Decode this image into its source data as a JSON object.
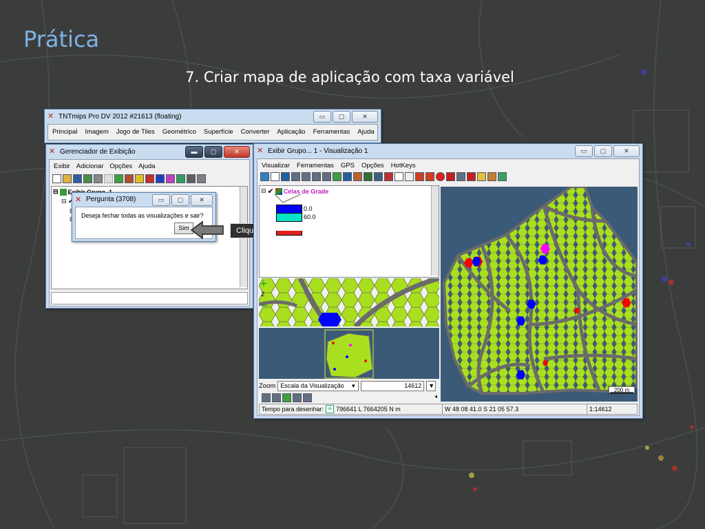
{
  "slide": {
    "title": "Prática",
    "subtitle": "7. Criar mapa de aplicação com taxa variável"
  },
  "main_window": {
    "title": "TNTmips Pro DV 2012  #21613 (floating)",
    "menu": [
      "Principal",
      "Imagem",
      "Jogo de Tiles",
      "Geométrico",
      "Superfície",
      "Converter",
      "Aplicação",
      "Ferramentas",
      "Ajuda"
    ]
  },
  "display_manager": {
    "title": "Gerenciador de Exibição",
    "menu": [
      "Exibir",
      "Adicionar",
      "Opções",
      "Ajuda"
    ],
    "tree_root": "Exibir Grupo_1"
  },
  "dialog": {
    "title": "Pergunta (3708)",
    "message": "Deseja fechar todas as visualizações e sair?",
    "yes_label": "Sim"
  },
  "callout": {
    "text": "Clique em “Sim” para finalizar."
  },
  "view_window": {
    "title": "Exibir Grupo... 1 - Visualização 1",
    "menu": [
      "Visualizar",
      "Ferramentas",
      "GPS",
      "Opções",
      "HotKeys"
    ],
    "layer_name": "Celas de Grade",
    "legend": [
      {
        "label": "0.0",
        "color": "#0000ff"
      },
      {
        "label": "60.0",
        "color": "#00e5c8"
      }
    ],
    "zoom_label": "Zoom",
    "zoom_mode": "Escala da Visualização",
    "zoom_value": "14612",
    "scale_bar": "200 m",
    "status": {
      "draw_time_label": "Tempo para desenhar:",
      "coords_map": "796641 L  7664205 N m",
      "coords_geo": "W 48 08 41.0  S 21 05 57.3",
      "scale": "1:14612"
    }
  },
  "colors": {
    "title_blue": "#7fb2e5",
    "window_frame": "#c9dcf0",
    "grid_fill": "#a8e020",
    "map_bg": "#3b5a78",
    "road": "#6b6b6b",
    "high_rate": "#ff0000",
    "low_rate": "#0000ff",
    "mid_rate": "#ff00ff"
  }
}
